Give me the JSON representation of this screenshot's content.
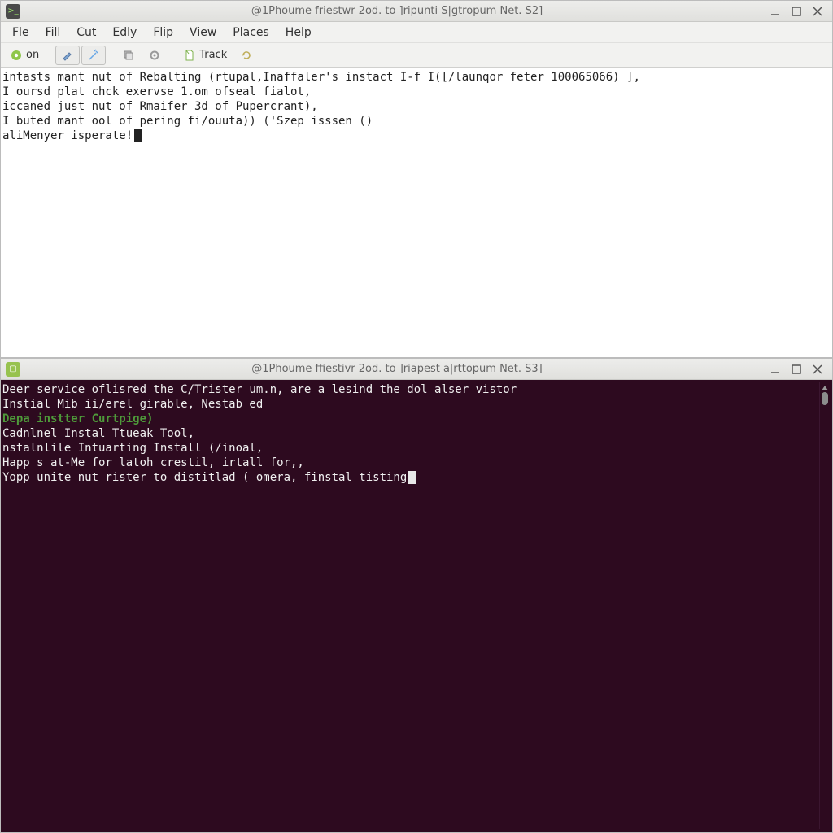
{
  "top_window": {
    "title": "@1Phoume friestwr 2od. to ]ripunti S|gtropum Net. S2]",
    "menubar": [
      "Fle",
      "Fill",
      "Cut",
      "Edly",
      "Flip",
      "View",
      "Places",
      "Help"
    ],
    "toolbar": {
      "btn_on": "on",
      "btn_track": "Track"
    },
    "lines": [
      "intasts mant nut of Rebalting (rtupal,Inaffaler's instact I-f I([/launqor feter 100065066) ],",
      "I oursd plat chck exervse 1.om ofseal fialot,",
      "iccaned just nut of Rmaifer 3d of Pupercrant),",
      "I buted mant ool of pering fi/ouuta)) ('Szep isssen ()",
      "aliMenyer isperate!"
    ]
  },
  "bottom_window": {
    "title": "@1Phoume ffiestivr 2od. to ]riapest a|rttopum Net. S3]",
    "lines": [
      "Deer service oflisred the C/Trister um.n, are a lesind the dol alser vistor",
      "Instial Mib ii/erel girable, Nestab ed",
      "",
      "Depa instter Curtpige)",
      "Cadnlnel Instal Ttueak Tool,",
      "nstalnlile Intuarting Install (/inoal,",
      "Happ s at-Me for latoh crestil, irtall for,,",
      "Yopp unite nut rister to distitlad ( omera, finstal tisting"
    ]
  },
  "icons": {
    "minimize": "minimize",
    "maximize": "maximize",
    "close": "close"
  }
}
